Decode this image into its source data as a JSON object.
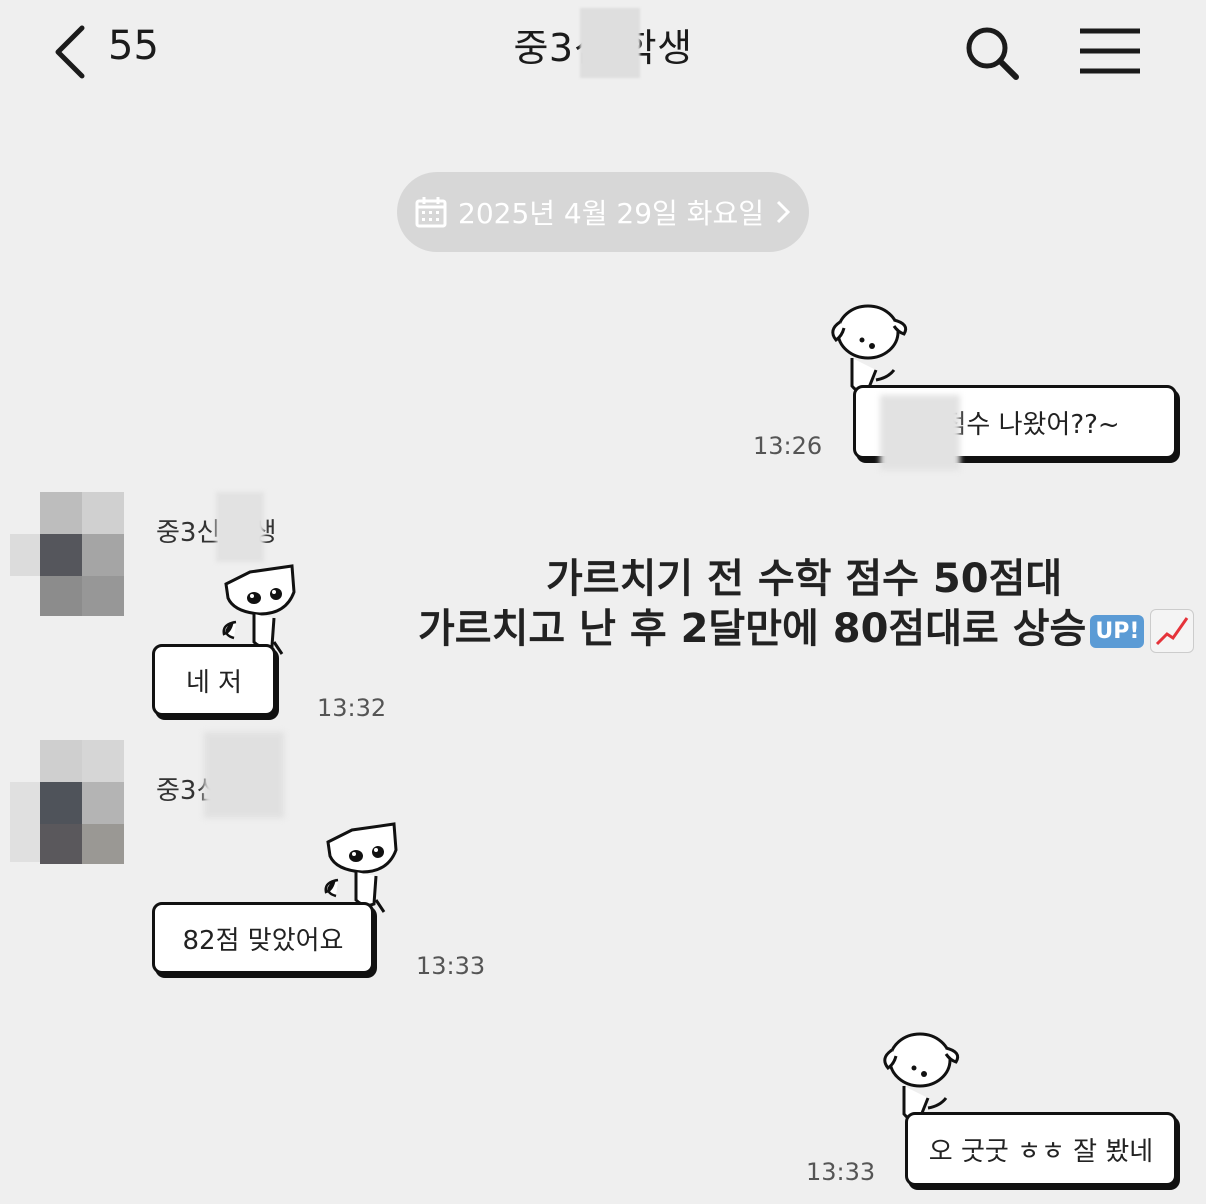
{
  "header": {
    "unread_count": "55",
    "chat_title": "중3신 학생"
  },
  "date_separator": "2025년 4월 29일 화요일",
  "messages": [
    {
      "side": "right",
      "text": "아 점수 나왔어??~",
      "time": "13:26"
    },
    {
      "side": "left",
      "sender": "중3신 학생",
      "text": "네 저",
      "time": "13:32"
    },
    {
      "side": "left",
      "sender": "중3신 학생",
      "text": "82점 맞았어요",
      "time": "13:33"
    },
    {
      "side": "right",
      "text": "오 굿굿 ㅎㅎ 잘 봤네",
      "time": "13:33"
    }
  ],
  "overlay_caption": {
    "line1": "가르치기 전 수학 점수 50점대",
    "line2": "가르치고 난 후 2달만에 80점대로 상승",
    "badge": "UP!"
  },
  "colors": {
    "background": "#efefef",
    "date_pill": "#d7d7d7",
    "bubble_border": "#111111"
  },
  "icons": {
    "back": "chevron-left-icon",
    "search": "search-icon",
    "menu": "hamburger-menu-icon",
    "calendar": "calendar-icon",
    "chart": "chart-increasing-icon"
  }
}
